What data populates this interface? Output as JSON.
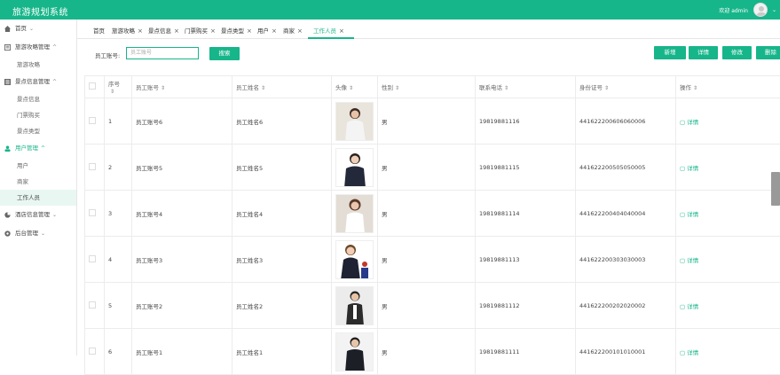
{
  "app": {
    "title": "旅游规划系统",
    "welcome": "欢迎 admin"
  },
  "sidebar": {
    "items": [
      {
        "label": "首页",
        "icon": "home-icon",
        "sub": []
      },
      {
        "label": "旅游攻略管理",
        "icon": "book-icon",
        "sub": [
          "旅游攻略"
        ]
      },
      {
        "label": "景点信息管理",
        "icon": "list-icon",
        "sub": [
          "景点信息",
          "门票购买",
          "景点类型"
        ]
      },
      {
        "label": "用户管理",
        "icon": "user-icon",
        "sub": [
          "用户",
          "商家",
          "工作人员"
        ]
      },
      {
        "label": "酒店信息管理",
        "icon": "pie-icon",
        "sub": []
      },
      {
        "label": "后台管理",
        "icon": "gear-icon",
        "sub": []
      }
    ]
  },
  "tabs": [
    "首页",
    "旅游攻略",
    "景点信息",
    "门票购买",
    "景点类型",
    "用户",
    "商家",
    "工作人员"
  ],
  "search": {
    "label": "员工账号:",
    "placeholder": "员工账号",
    "button": "搜索"
  },
  "toolbar": {
    "add": "新增",
    "detail": "详情",
    "edit": "修改",
    "delete": "删除"
  },
  "table": {
    "headers": [
      "序号",
      "员工账号",
      "员工姓名",
      "头像",
      "性别",
      "联系电话",
      "身份证号",
      "操作"
    ],
    "action_label": "详情",
    "rows": [
      {
        "no": "1",
        "account": "员工账号6",
        "name": "员工姓名6",
        "gender": "男",
        "phone": "19819881116",
        "id_card": "441622200606060006"
      },
      {
        "no": "2",
        "account": "员工账号5",
        "name": "员工姓名5",
        "gender": "男",
        "phone": "19819881115",
        "id_card": "441622200505050005"
      },
      {
        "no": "3",
        "account": "员工账号4",
        "name": "员工姓名4",
        "gender": "男",
        "phone": "19819881114",
        "id_card": "441622200404040004"
      },
      {
        "no": "4",
        "account": "员工账号3",
        "name": "员工姓名3",
        "gender": "男",
        "phone": "19819881113",
        "id_card": "441622200303030003"
      },
      {
        "no": "5",
        "account": "员工账号2",
        "name": "员工姓名2",
        "gender": "男",
        "phone": "19819881112",
        "id_card": "441622200202020002"
      },
      {
        "no": "6",
        "account": "员工账号1",
        "name": "员工姓名1",
        "gender": "男",
        "phone": "19819881111",
        "id_card": "441622200101010001"
      }
    ]
  },
  "colors": {
    "accent": "#17b58a",
    "topbar": "#17b58a"
  }
}
